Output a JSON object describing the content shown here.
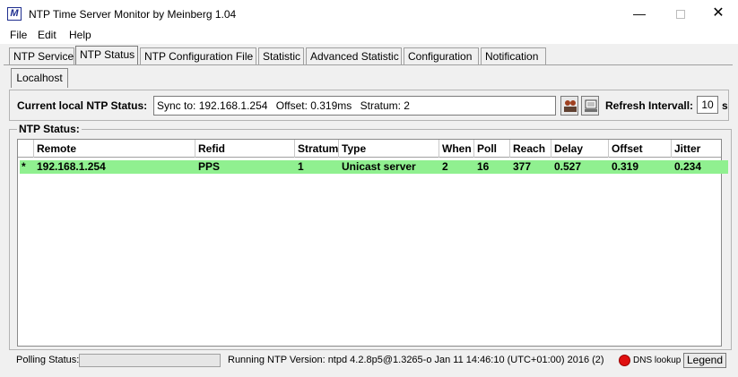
{
  "window": {
    "title": "NTP Time Server Monitor by Meinberg 1.04",
    "icon_glyph": "M",
    "controls": {
      "minimize": "—",
      "close": "✕"
    }
  },
  "menu": [
    "File",
    "Edit",
    "Help"
  ],
  "tabs": [
    {
      "label": "NTP Service",
      "active": false
    },
    {
      "label": "NTP Status",
      "active": true
    },
    {
      "label": "NTP Configuration File",
      "active": false
    },
    {
      "label": "Statistic",
      "active": false
    },
    {
      "label": "Advanced Statistic",
      "active": false
    },
    {
      "label": "Configuration",
      "active": false
    },
    {
      "label": "Notification",
      "active": false
    }
  ],
  "subtab": {
    "label": "Localhost"
  },
  "status": {
    "label": "Current local NTP Status:",
    "sync": "Sync to: 192.168.1.254",
    "offset": "Offset: 0.319ms",
    "stratum": "Stratum: 2",
    "refresh_label": "Refresh Intervall:",
    "refresh_value": "10",
    "refresh_unit": "s",
    "icons": [
      "peers-icon",
      "monitor-icon"
    ]
  },
  "ntp_status": {
    "group_title": "NTP Status:",
    "columns": [
      "",
      "Remote",
      "Refid",
      "Stratum",
      "Type",
      "When",
      "Poll",
      "Reach",
      "Delay",
      "Offset",
      "Jitter"
    ],
    "rows": [
      {
        "mark": "*",
        "remote": "192.168.1.254",
        "refid": "PPS",
        "stratum": "1",
        "type": "Unicast server",
        "when": "2",
        "poll": "16",
        "reach": "377",
        "delay": "0.527",
        "offset": "0.319",
        "jitter": "0.234"
      }
    ],
    "row_color": "#90f090"
  },
  "statusbar": {
    "polling_label": "Polling Status:",
    "version": "Running NTP Version:  ntpd 4.2.8p5@1.3265-o Jan 11 14:46:10 (UTC+01:00) 2016  (2)",
    "dns_label": "DNS lookup",
    "dns_color": "#e01010",
    "legend_label": "Legend"
  }
}
